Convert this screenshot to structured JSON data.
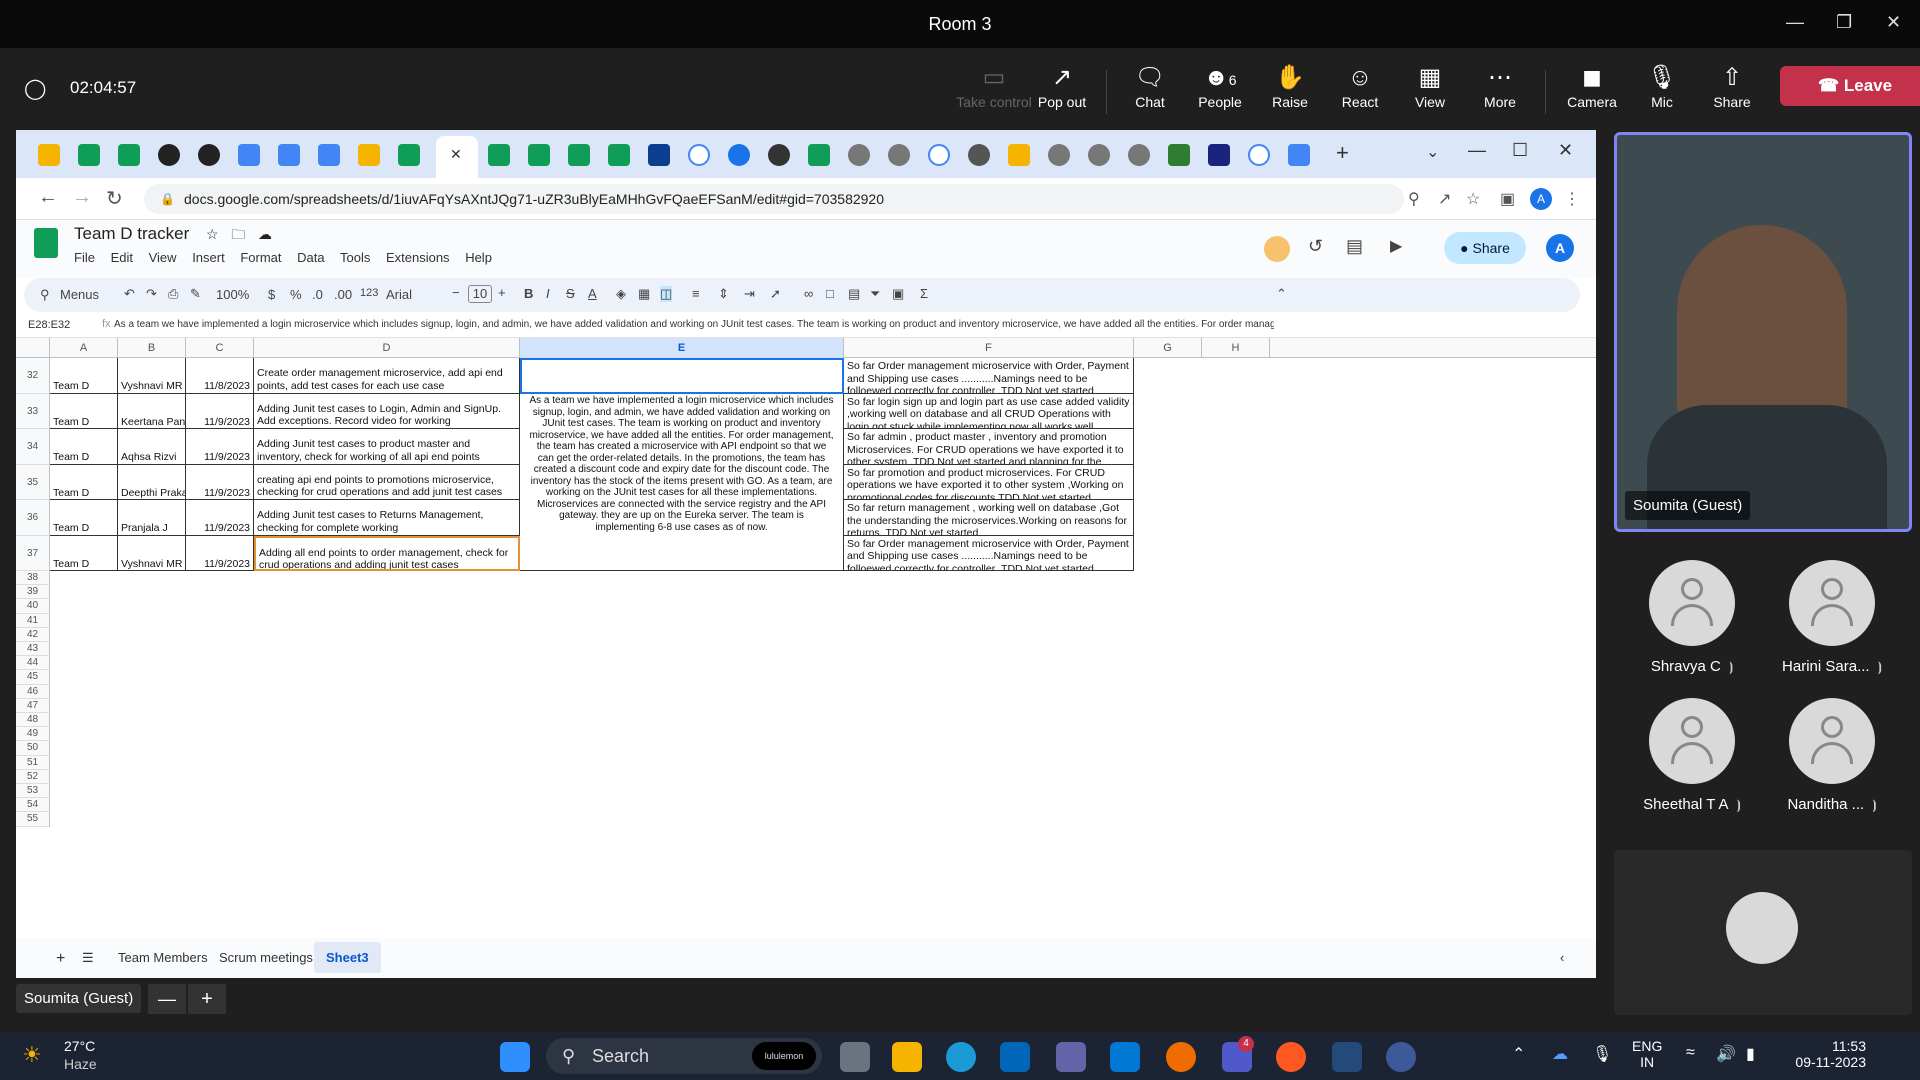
{
  "window": {
    "title": "Room 3"
  },
  "meeting": {
    "timer": "02:04:57",
    "buttons": [
      {
        "label": "Take control",
        "icon": "take-control-icon"
      },
      {
        "label": "Pop out",
        "icon": "pop-out-icon"
      },
      {
        "label": "Chat",
        "icon": "chat-icon"
      },
      {
        "label": "People",
        "icon": "people-icon",
        "count": "6"
      },
      {
        "label": "Raise",
        "icon": "raise-hand-icon"
      },
      {
        "label": "React",
        "icon": "react-icon"
      },
      {
        "label": "View",
        "icon": "view-icon"
      },
      {
        "label": "More",
        "icon": "more-icon"
      },
      {
        "label": "Camera",
        "icon": "camera-off-icon"
      },
      {
        "label": "Mic",
        "icon": "mic-off-icon"
      },
      {
        "label": "Share",
        "icon": "share-icon"
      }
    ],
    "leave_label": "Leave",
    "accent": "#c4314b"
  },
  "browser": {
    "url": "docs.google.com/spreadsheets/d/1iuvAFqYsAXntJQg71-uZR3uBlyEaMHhGvFQaeEFSanM/edit#gid=703582920"
  },
  "sheet": {
    "title": "Team D tracker",
    "menus": [
      "File",
      "Edit",
      "View",
      "Insert",
      "Format",
      "Data",
      "Tools",
      "Extensions",
      "Help"
    ],
    "share_label": "Share",
    "avatar_letter": "A",
    "toolbar": {
      "menus": "Menus",
      "zoom": "100%",
      "currency": "$",
      "percent": "%",
      "dec_less": ".0",
      "dec_more": ".00",
      "format123": "123",
      "font": "Arial",
      "font_size": "10"
    },
    "namebox": "E28:E32",
    "formula": "As a team we have implemented a login microservice which includes signup, login, and admin, we have added validation and working on JUnit test cases. The team is working on product and inventory microservice, we have added all the entities. For order management, the team has created a microservice with API",
    "columns": [
      "A",
      "B",
      "C",
      "D",
      "E",
      "F",
      "G",
      "H"
    ],
    "rows": [
      {
        "num": "32",
        "team": "Team D",
        "name": "Vyshnavi MR",
        "date": "11/8/2023",
        "task": "Create  order management microservice, add api end points, add test cases for each use case",
        "status": "So far Order management microservice with Order, Payment and Shipping use cases ...........Namings need to be  folloewed correctly for controller ,TDD Not yet started"
      },
      {
        "num": "33",
        "team": "Team D",
        "name": "Keertana Pandit",
        "date": "11/9/2023",
        "task": "Adding Junit test cases to Login, Admin and SignUp. Add exceptions. Record video for working",
        "status": "So far login sign up and login part as use case added validity ,working well on database and all CRUD Operations with login got stuck while implementing now all works well"
      },
      {
        "num": "34",
        "team": "Team D",
        "name": "Aqhsa Rizvi",
        "date": "11/9/2023",
        "task": "Adding Junit test cases to product master and inventory, check for working of all api end points",
        "status": "So far admin , product master , inventory and promotion Microservices. For CRUD operations we have exported it to other system ,TDD Not yet started and planning for the testcases"
      },
      {
        "num": "35",
        "team": "Team D",
        "name": "Deepthi Prakash",
        "date": "11/9/2023",
        "task": "creating api end points to promotions microservice, checking for crud operations and add junit test cases",
        "status": "So far promotion and product microservices. For CRUD operations we have exported it to other system ,Working on promotional codes for discounts,TDD Not yet started"
      },
      {
        "num": "36",
        "team": "Team D",
        "name": "Pranjala J",
        "date": "11/9/2023",
        "task": "Adding Junit test cases to Returns Management, checking for complete working",
        "status": "So far return management , working well on database ,Got the understanding the microservices.Working on reasons for returns ,TDD Not yet started"
      },
      {
        "num": "37",
        "team": "Team D",
        "name": "Vyshnavi MR",
        "date": "11/9/2023",
        "task": "Adding all end points to order management, check for crud operations and adding junit test cases",
        "status": "So far Order management microservice with Order, Payment and Shipping use cases ...........Namings need to be  folloewed correctly for controller ,TDD Not yet started"
      }
    ],
    "merged_e": "As a team we have implemented a login microservice which includes signup, login, and admin, we have added validation and working on JUnit test cases. The team is working on product and inventory microservice, we have added all the entities. For order management, the team has created a microservice with API endpoint so that we can get the order-related details. In the promotions, the team has created a discount code and expiry date for the discount code. The inventory has the stock of the items present with GO. As a team, are working on the JUnit test cases for all these implementations. Microservices are connected with the service registry and the API gateway. they are up on the Eureka server. The team is implementing 6-8 use cases as of now.",
    "empty_rows": [
      "38",
      "39",
      "40",
      "41",
      "42",
      "43",
      "44",
      "45",
      "46",
      "47",
      "48",
      "49",
      "50",
      "51",
      "52",
      "53",
      "54",
      "55"
    ],
    "tabs": [
      "Team Members",
      "Scrum meetings",
      "Sheet3"
    ],
    "active_tab": "Sheet3"
  },
  "presenter_label": "Soumita (Guest)",
  "video": {
    "name": "Soumita (Guest)"
  },
  "participants": [
    {
      "name": "Shravya C"
    },
    {
      "name": "Harini Sara..."
    },
    {
      "name": "Sheethal T A"
    },
    {
      "name": "Nanditha ..."
    }
  ],
  "taskbar": {
    "weather_temp": "27°C",
    "weather_desc": "Haze",
    "search_placeholder": "Search",
    "search_badge": "lululemon",
    "lang1": "ENG",
    "lang2": "IN",
    "time": "11:53",
    "date": "09-11-2023",
    "teams_badge": "4"
  }
}
